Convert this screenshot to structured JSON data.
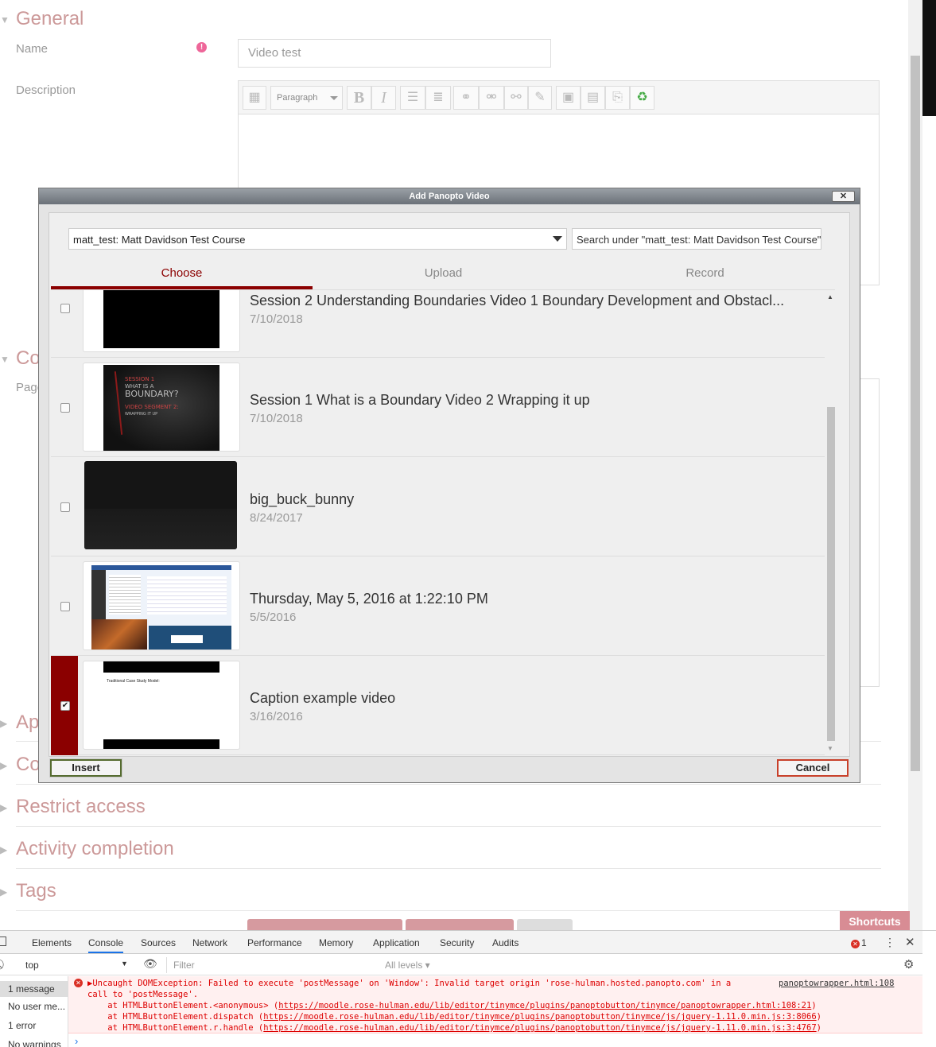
{
  "page": {
    "sections": {
      "general": "General",
      "content_partial": "Co",
      "appearance_partial": "Ap",
      "common_partial": "Co",
      "restrict": "Restrict access",
      "activity": "Activity completion",
      "tags": "Tags"
    },
    "labels": {
      "name": "Name",
      "description": "Description",
      "page_partial": "Page"
    },
    "name_value": "Video test",
    "editor": {
      "paragraph": "Paragraph",
      "bold": "B",
      "italic": "I"
    },
    "shortcuts": "Shortcuts"
  },
  "dialog": {
    "title": "Add Panopto Video",
    "close": "✕",
    "folder": "matt_test: Matt Davidson Test Course",
    "search_placeholder": "Search under \"matt_test: Matt Davidson Test Course\"",
    "tabs": [
      "Choose",
      "Upload",
      "Record"
    ],
    "videos": [
      {
        "title": "Session 2 Understanding Boundaries Video 1 Boundary Development and Obstacl...",
        "date": "7/10/2018",
        "checked": false
      },
      {
        "title": "Session 1 What is a Boundary Video 2 Wrapping it up",
        "date": "7/10/2018",
        "checked": false,
        "thumb_text": [
          "SESSION 1",
          "WHAT IS A",
          "BOUNDARY?",
          "VIDEO SEGMENT 2:",
          "WRAPPING IT UP"
        ]
      },
      {
        "title": "big_buck_bunny",
        "date": "8/24/2017",
        "checked": false
      },
      {
        "title": "Thursday, May 5, 2016 at 1:22:10 PM",
        "date": "5/5/2016",
        "checked": false
      },
      {
        "title": "Caption example video",
        "date": "3/16/2016",
        "checked": true,
        "thumb_text": [
          "Traditional Case Study Model:"
        ]
      }
    ],
    "insert": "Insert",
    "cancel": "Cancel"
  },
  "devtools": {
    "tabs": [
      "Elements",
      "Console",
      "Sources",
      "Network",
      "Performance",
      "Memory",
      "Application",
      "Security",
      "Audits"
    ],
    "error_count": "1",
    "context": "top",
    "filter_placeholder": "Filter",
    "levels": "All levels ▾",
    "sidebar": [
      "1 message",
      "No user me...",
      "1 error",
      "No warnings"
    ],
    "error": {
      "line1": "▶Uncaught DOMException: Failed to execute 'postMessage' on 'Window': Invalid target origin 'rose-hulman.hosted.panopto.com' in a",
      "line2": "call to 'postMessage'.",
      "at1_prefix": "    at HTMLButtonElement.<anonymous> (",
      "at1_url": "https://moodle.rose-hulman.edu/lib/editor/tinymce/plugins/panoptobutton/tinymce/panoptowrapper.html:108:21",
      "at2_prefix": "    at HTMLButtonElement.dispatch (",
      "at2_url": "https://moodle.rose-hulman.edu/lib/editor/tinymce/plugins/panoptobutton/tinymce/js/jquery-1.11.0.min.js:3:8066",
      "at3_prefix": "    at HTMLButtonElement.r.handle (",
      "at3_url": "https://moodle.rose-hulman.edu/lib/editor/tinymce/plugins/panoptobutton/tinymce/js/jquery-1.11.0.min.js:3:4767",
      "source": "panoptowrapper.html:108"
    },
    "prompt": "›"
  },
  "colors": {
    "accent": "#8b0000",
    "section_heading": "#cc9999",
    "error_red": "#d93025"
  }
}
